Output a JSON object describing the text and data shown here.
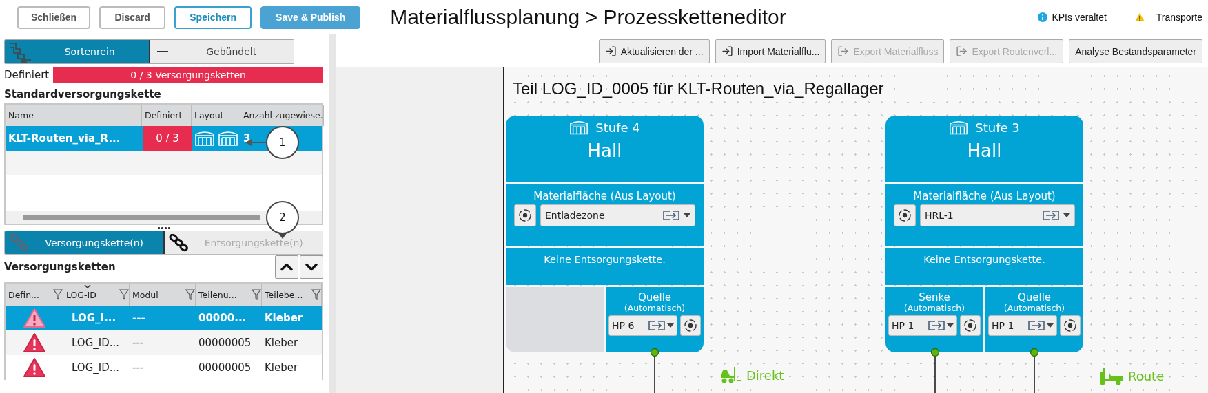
{
  "top_buttons": [
    {
      "label": "Schließen",
      "kind": "outline"
    },
    {
      "label": "Discard",
      "kind": "outline"
    },
    {
      "label": "Speichern",
      "kind": "primary-outline"
    },
    {
      "label": "Save & Publish",
      "kind": "filled"
    }
  ],
  "breadcrumb": {
    "parent": "Materialflussplanung",
    "separator": ">",
    "current": "Prozessketteneditor"
  },
  "status": [
    {
      "label": "KPIs veraltet",
      "kind": "info"
    },
    {
      "label": "Transporte",
      "kind": "warning"
    }
  ],
  "mode_toggle": [
    {
      "label": "Sortenrein",
      "kind": "stairs",
      "selected": true
    },
    {
      "label": "Gebündelt",
      "kind": "dash",
      "selected": false
    }
  ],
  "definiert": {
    "label": "Definiert",
    "value": "0 / 3 Versorgungsketten"
  },
  "standard": {
    "title": "Standardversorgungskette",
    "columns": [
      "Name",
      "Definiert",
      "Layout",
      "Anzahl zugewiese."
    ],
    "rows": [
      {
        "name": "KLT-Routen_via_R...",
        "definiert": "0 / 3",
        "layout": [
          {
            "kind": "hall"
          },
          {
            "kind": "hall"
          }
        ],
        "count": "3",
        "selected": true
      }
    ]
  },
  "callouts": [
    {
      "label": "1",
      "kind": "left-arrow"
    },
    {
      "label": "2",
      "kind": "down-pointer"
    }
  ],
  "chain_tabs": [
    {
      "label": "Versorgungskette(n)",
      "selected": true,
      "disabled": false
    },
    {
      "label": "Entsorgungskette(n)",
      "selected": false,
      "disabled": true
    }
  ],
  "chains": {
    "title": "Versorgungsketten",
    "columns": [
      {
        "label": "Defin...",
        "sorted": false
      },
      {
        "label": "LOG-ID",
        "sorted": true
      },
      {
        "label": "Modul",
        "sorted": false
      },
      {
        "label": "Teilenu...",
        "sorted": false
      },
      {
        "label": "Teilebe...",
        "sorted": false
      }
    ],
    "rows": [
      {
        "kind": "warning",
        "log_id": "LOG_I...",
        "modul": "---",
        "teilenummer": "00000...",
        "teilebezeichnung": "Kleber",
        "selected": true
      },
      {
        "kind": "warning",
        "log_id": "LOG_ID...",
        "modul": "---",
        "teilenummer": "00000005",
        "teilebezeichnung": "Kleber",
        "selected": false
      },
      {
        "kind": "warning",
        "log_id": "LOG_ID...",
        "modul": "---",
        "teilenummer": "00000005",
        "teilebezeichnung": "Kleber",
        "selected": false
      }
    ]
  },
  "actions": [
    {
      "label": "Aktualisieren der ...",
      "kind": "import",
      "disabled": false
    },
    {
      "label": "Import Materialflu...",
      "kind": "import",
      "disabled": false
    },
    {
      "label": "Export Materialfluss",
      "kind": "export",
      "disabled": true
    },
    {
      "label": "Export Routenverl...",
      "kind": "export",
      "disabled": true
    },
    {
      "label": "Analyse Bestandsparameter",
      "kind": "plain",
      "disabled": false
    }
  ],
  "canvas": {
    "title": "Teil LOG_ID_0005 für KLT-Routen_via_Regallager",
    "stages": [
      {
        "stage": "Stufe 4",
        "name": "Hall",
        "area_label": "Materialfläche (Aus Layout)",
        "area_value": "Entladezone",
        "disposal": "Keine Entsorgungskette.",
        "ports": [
          {
            "kind": "empty"
          },
          {
            "kind": "port",
            "title": "Quelle",
            "subtitle": "(Automatisch)",
            "value": "HP 6"
          }
        ]
      },
      {
        "stage": "Stufe 3",
        "name": "Hall",
        "area_label": "Materialfläche (Aus Layout)",
        "area_value": "HRL-1",
        "disposal": "Keine Entsorgungskette.",
        "ports": [
          {
            "kind": "port",
            "title": "Senke",
            "subtitle": "(Automatisch)",
            "value": "HP 1"
          },
          {
            "kind": "port",
            "title": "Quelle",
            "subtitle": "(Automatisch)",
            "value": "HP 1"
          }
        ]
      }
    ],
    "transports": [
      {
        "label": "Direkt",
        "kind": "forklift"
      },
      {
        "label": "Route",
        "kind": "tugger"
      }
    ]
  }
}
